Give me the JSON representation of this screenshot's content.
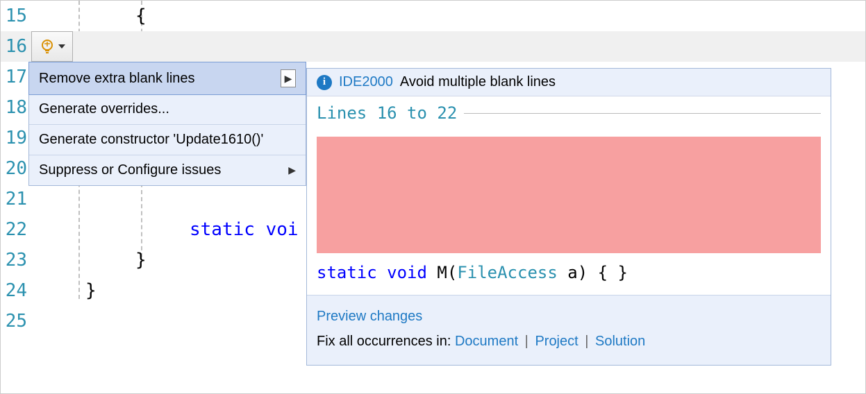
{
  "gutter": {
    "lines": [
      "15",
      "16",
      "17",
      "18",
      "19",
      "20",
      "21",
      "22",
      "23",
      "24",
      "25"
    ],
    "highlight_index": 1
  },
  "code": {
    "line15_brace": "{",
    "line22_static_void": "static voi",
    "line23_brace": "}",
    "line24_brace": "}"
  },
  "quick_actions": {
    "item0": "Remove extra blank lines",
    "item1": "Generate overrides...",
    "item2": "Generate constructor 'Update1610()'",
    "item3": "Suppress or Configure issues"
  },
  "preview": {
    "rule_id": "IDE2000",
    "rule_msg": "Avoid multiple blank lines",
    "range_label": "Lines 16 to 22",
    "code_kw1": "static",
    "code_kw2": "void",
    "code_method": " M(",
    "code_type": "FileAccess",
    "code_rest": " a) { }",
    "preview_changes": "Preview changes",
    "fix_prefix": "Fix all occurrences in: ",
    "fix_document": "Document",
    "fix_project": "Project",
    "fix_solution": "Solution"
  }
}
